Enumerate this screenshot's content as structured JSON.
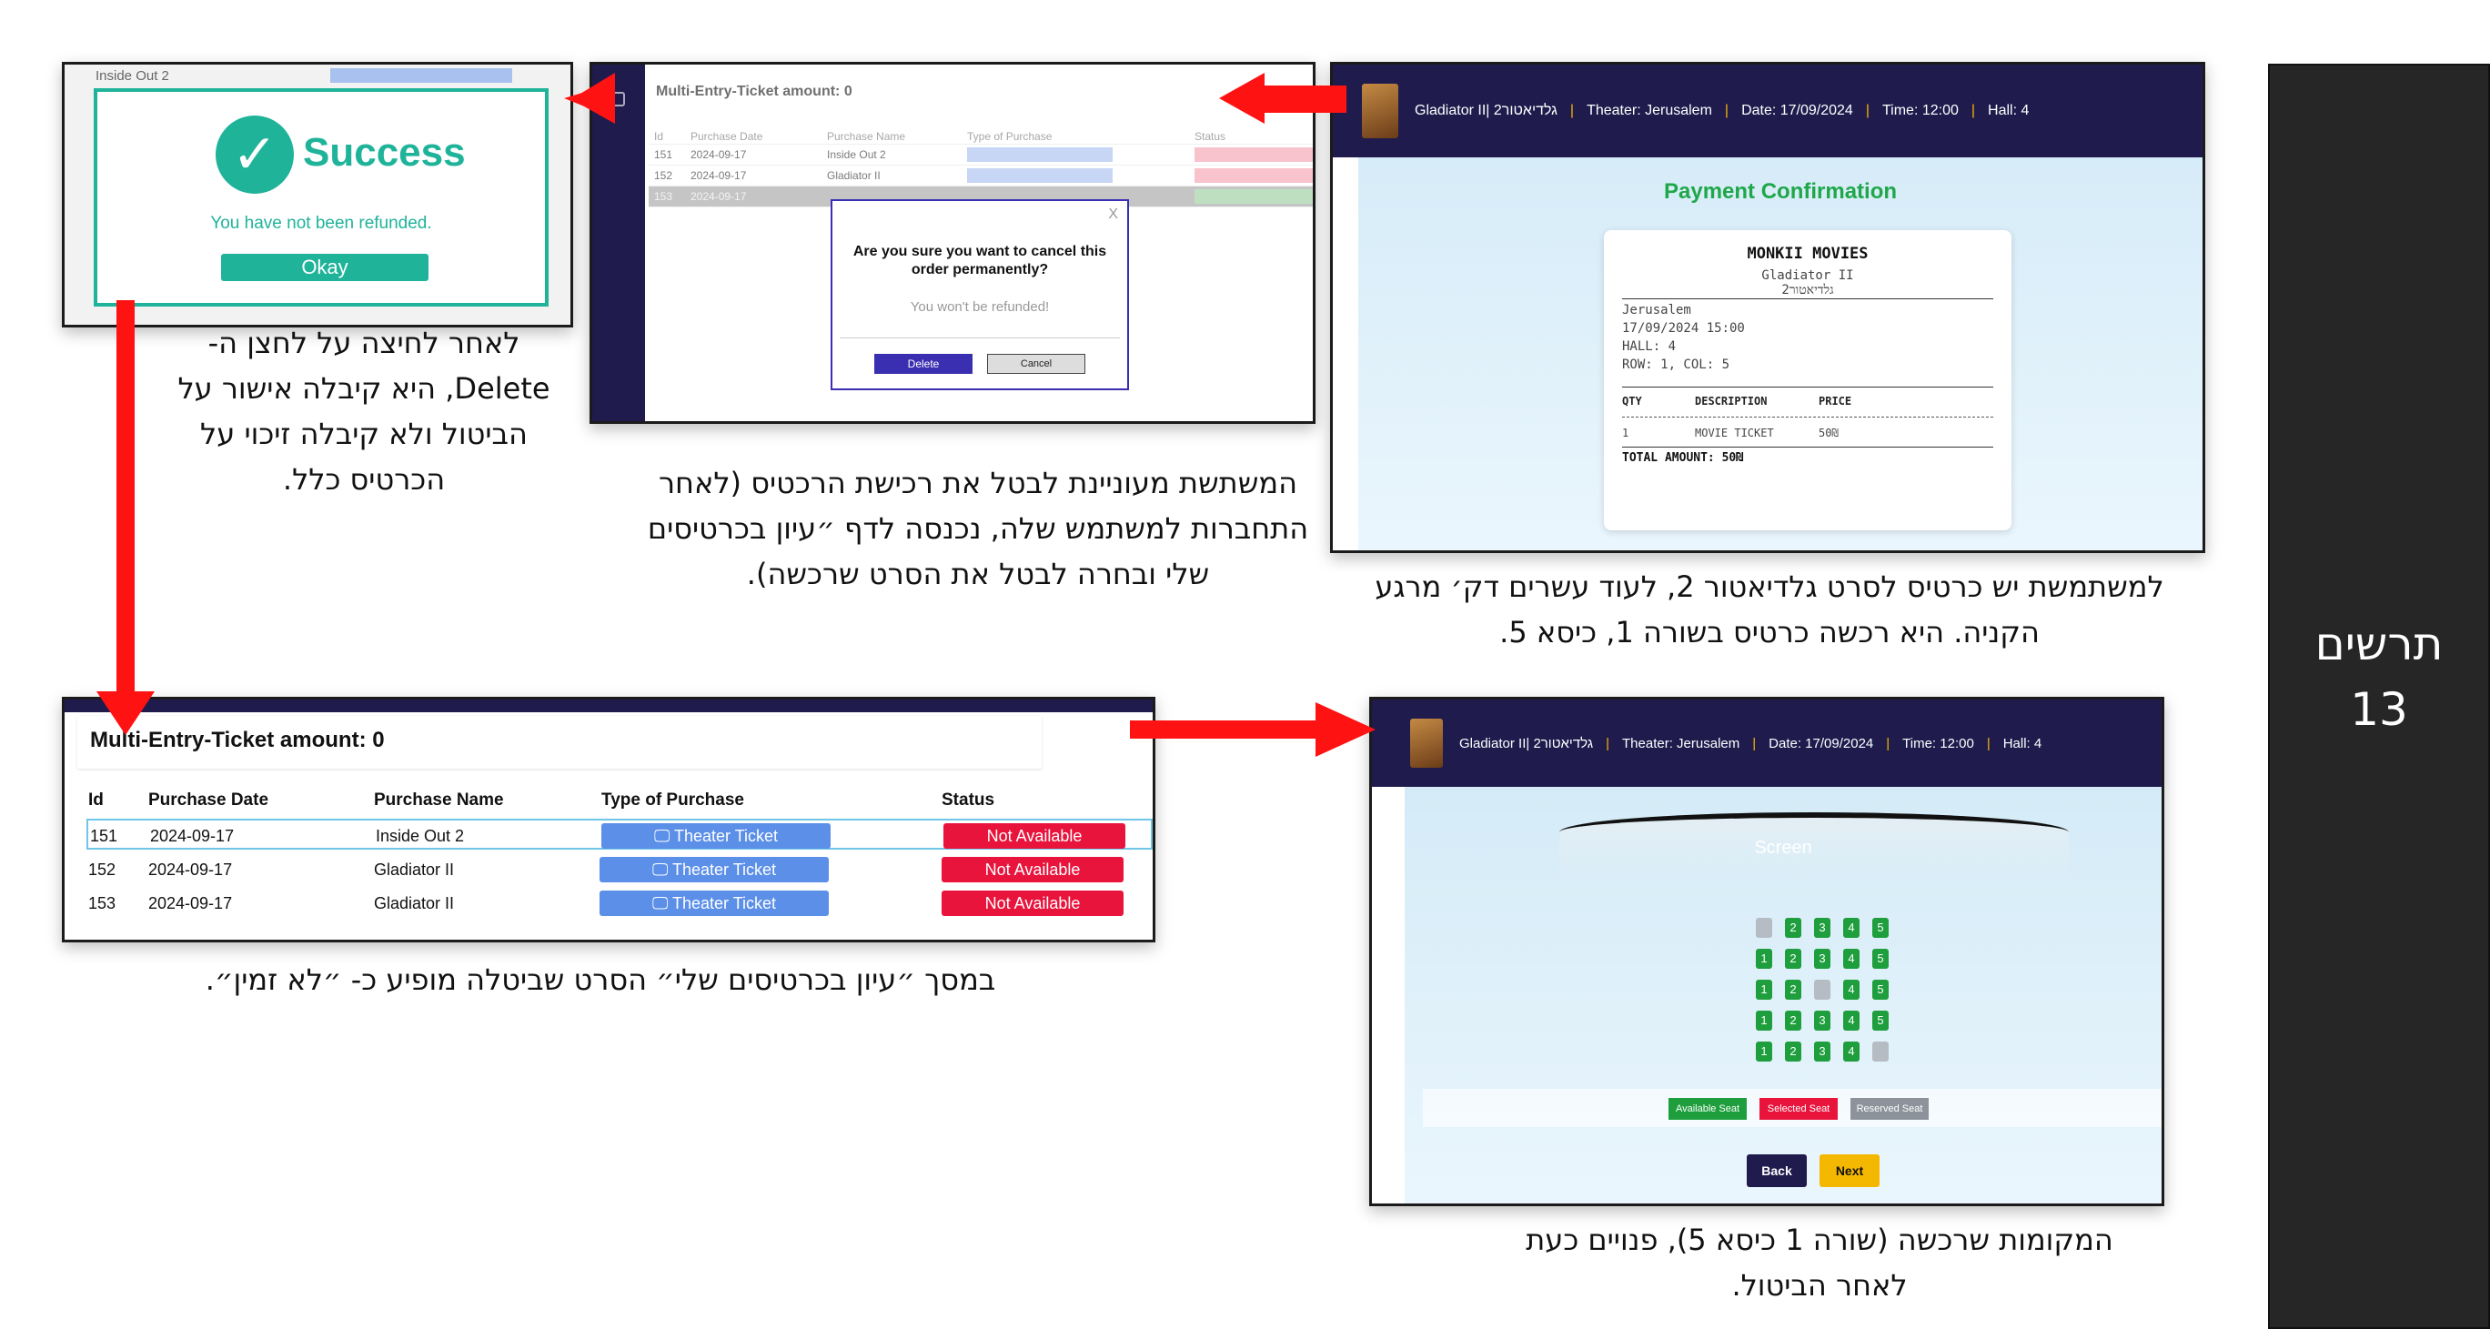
{
  "side_panel": {
    "line1": "תרשים",
    "line2": "13"
  },
  "success_shot": {
    "bg_row_label": "Inside Out 2",
    "title": "Success",
    "message": "You have not been refunded.",
    "ok_label": "Okay"
  },
  "cancel_shot": {
    "header": "Multi-Entry-Ticket amount: 0",
    "columns": [
      "Id",
      "Purchase Date",
      "Purchase Name",
      "Type of Purchase",
      "Status"
    ],
    "rows": [
      {
        "id": "151",
        "date": "2024-09-17",
        "name": "Inside Out 2"
      },
      {
        "id": "152",
        "date": "2024-09-17",
        "name": "Gladiator II"
      },
      {
        "id": "153",
        "date": "2024-09-17",
        "name": ""
      }
    ],
    "modal": {
      "close": "X",
      "question": "Are you sure you want to cancel this order permanently?",
      "warning": "You won't be refunded!",
      "delete_label": "Delete",
      "cancel_label": "Cancel"
    }
  },
  "payment_shot": {
    "topbar": {
      "movie": "Gladiator II| גלדיאטור2",
      "theater": "Theater: Jerusalem",
      "date": "Date: 17/09/2024",
      "time": "Time: 12:00",
      "hall": "Hall: 4"
    },
    "title": "Payment Confirmation",
    "receipt": {
      "brand": "MONKII MOVIES",
      "movie_en": "Gladiator II",
      "movie_he": "גלדיאטור2",
      "city": "Jerusalem",
      "datetime": "17/09/2024 15:00",
      "hall": "HALL: 4",
      "seat": "ROW: 1, COL: 5",
      "col_qty": "QTY",
      "col_desc": "DESCRIPTION",
      "col_price": "PRICE",
      "item_qty": "1",
      "item_desc": "MOVIE TICKET",
      "item_price": "50₪",
      "total": "TOTAL AMOUNT: 50₪"
    }
  },
  "table_shot": {
    "header": "Multi-Entry-Ticket amount: 0",
    "columns": [
      "Id",
      "Purchase Date",
      "Purchase Name",
      "Type of Purchase",
      "Status"
    ],
    "rows": [
      {
        "id": "151",
        "date": "2024-09-17",
        "name": "Inside Out 2",
        "type": "Theater Ticket",
        "status": "Not Available"
      },
      {
        "id": "152",
        "date": "2024-09-17",
        "name": "Gladiator II",
        "type": "Theater Ticket",
        "status": "Not Available"
      },
      {
        "id": "153",
        "date": "2024-09-17",
        "name": "Gladiator II",
        "type": "Theater Ticket",
        "status": "Not Available"
      }
    ]
  },
  "seat_shot": {
    "topbar": {
      "movie": "Gladiator II| גלדיאטור2",
      "theater": "Theater: Jerusalem",
      "date": "Date: 17/09/2024",
      "time": "Time: 12:00",
      "hall": "Hall: 4"
    },
    "screen_label": "Screen",
    "legend": {
      "available": "Available Seat",
      "selected": "Selected Seat",
      "reserved": "Reserved Seat"
    },
    "back_label": "Back",
    "next_label": "Next"
  },
  "captions": {
    "success": "לאחר לחיצה על לחצן ה-Delete, היא קיבלה אישור על הביטול ולא קיבלה זיכוי על הכרטיס כלל.",
    "cancel": "המשתשת מעוניינת לבטל את רכישת הרכטיס (לאחר התחברות למשתמש שלה, נכנסה לדף ״עיון בכרטיסים שלי ובחרה לבטל את הסרט שרכשה).",
    "payment": "למשתמשת יש כרטיס לסרט גלדיאטור 2, לעוד עשרים דק׳ מרגע הקניה. היא רכשה כרטיס בשורה 1, כיסא 5.",
    "table": "במסך ״עיון בכרטיסים שלי״ הסרט שביטלה מופיע כ- ״לא זמין״.",
    "seat": "המקומות שרכשה (שורה 1 כיסא 5), פנויים כעת לאחר הביטול."
  },
  "colors": {
    "arrow": "#ff1212",
    "navy": "#1f1b4d",
    "success": "#1fb39a",
    "available": "#1e9e3c",
    "unavailable": "#e8143c",
    "theater_btn": "#5b8fe8"
  }
}
